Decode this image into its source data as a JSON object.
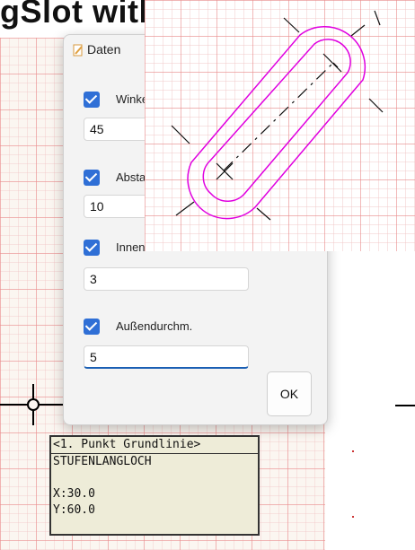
{
  "heading": {
    "text": "gSlot with Edge"
  },
  "dialog": {
    "title": "Daten",
    "fields": [
      {
        "label": "Winkel",
        "value": "45",
        "checked": true
      },
      {
        "label": "Abstand",
        "value": "10",
        "checked": true
      },
      {
        "label": "Innendurchm.",
        "value": "3",
        "checked": true
      },
      {
        "label": "Außendurchm.",
        "value": "5",
        "checked": true
      }
    ],
    "ok_label": "OK"
  },
  "status": {
    "lines": [
      "<1. Punkt Grundlinie>",
      "STUFENLANGLOCH",
      "",
      "X:30.0",
      "Y:60.0"
    ]
  },
  "colors": {
    "accent": "#2f6fd6",
    "slot": "#e000e0",
    "grid": "#eb8c8c"
  }
}
